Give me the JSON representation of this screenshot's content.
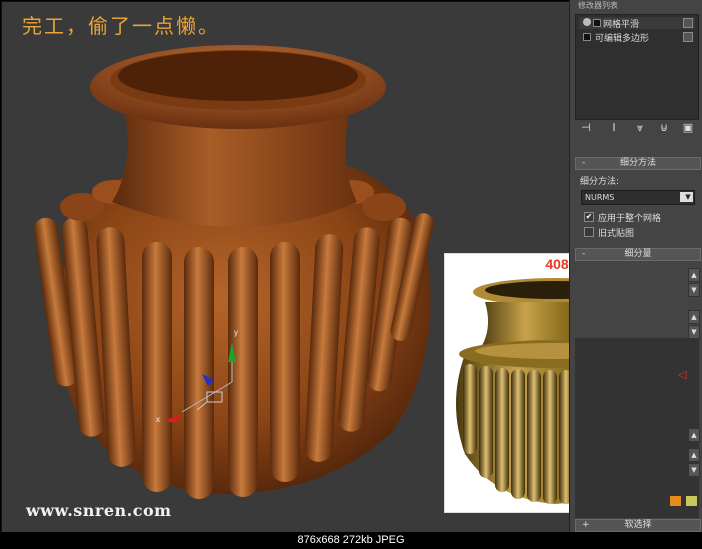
{
  "viewport": {
    "caption": "完工，偷了一点懒。",
    "watermark": "www.snren.com",
    "axis_labels": {
      "y": "y",
      "x": "x"
    }
  },
  "reference_photo": {
    "number": "408"
  },
  "panel": {
    "modifier_list_title": "修改器列表",
    "stack_items": [
      {
        "label": "网格平滑"
      },
      {
        "label": "可编辑多边形"
      }
    ],
    "toolbar_icons": [
      "pin-stack-icon",
      "show-end-result-icon",
      "make-unique-icon",
      "remove-modifier-icon",
      "configure-modifier-sets-icon"
    ],
    "subdivision_method": {
      "rollout_title": "细分方法",
      "sign": "-",
      "method_label": "细分方法:",
      "method_value": "NURMS",
      "apply_whole_mesh": {
        "label": "应用于整个网格",
        "checked": true,
        "mark": "✔"
      },
      "old_style_mapping": {
        "label": "旧式贴图",
        "checked": false,
        "mark": ""
      }
    },
    "subdivision_amount": {
      "rollout_title": "细分量",
      "sign": "-"
    },
    "soft_selection": {
      "rollout_title": "软选择",
      "sign": "+"
    },
    "swatch_colors": [
      "#e88a1c",
      "#c8c85a"
    ]
  },
  "status_bar": {
    "text": "876x668  272kb  JPEG"
  }
}
